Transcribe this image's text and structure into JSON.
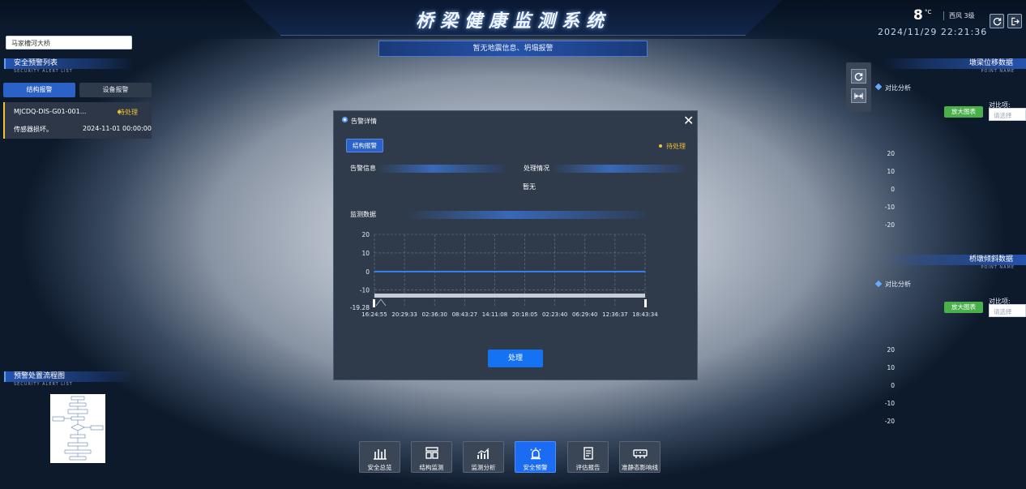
{
  "header": {
    "title": "桥梁健康监测系统",
    "temperature": "8",
    "temperature_unit": "°C",
    "wind": "西风 3级",
    "datetime": "2024/11/29 22:21:36",
    "icons": [
      "refresh-icon",
      "logout-icon"
    ]
  },
  "bridge_select": {
    "value": "马家槽河大桥"
  },
  "banner": {
    "text": "暂无地震信息、坍塌报警"
  },
  "left_panel": {
    "alert_list": {
      "title": "安全预警列表",
      "subtitle": "SECURITY ALERT LIST"
    },
    "tabs": [
      {
        "label": "结构报警",
        "active": true
      },
      {
        "label": "设备报警",
        "active": false
      }
    ],
    "alert": {
      "code": "MJCDQ-DIS-G01-001...",
      "status": "待处理",
      "description": "传感器损坏。",
      "time": "2024-11-01 00:00:00"
    },
    "flow": {
      "title": "预警处置流程图",
      "subtitle": "SECURITY ALERT LIST"
    }
  },
  "right_panel": {
    "beam": {
      "title": "墩梁位移数据",
      "subtitle": "POINT NAME",
      "analysis_label": "对比分析",
      "zoom_button": "放大图表",
      "compare_label": "对比项:",
      "compare_placeholder": "请选择",
      "y_ticks": [
        "20",
        "10",
        "0",
        "-10",
        "-20"
      ]
    },
    "pier": {
      "title": "桥墩倾斜数据",
      "subtitle": "POINT NAME",
      "analysis_label": "对比分析",
      "zoom_button": "放大图表",
      "compare_label": "对比项:",
      "compare_placeholder": "请选择",
      "y_ticks": [
        "20",
        "10",
        "0",
        "-10",
        "-20"
      ]
    }
  },
  "modal": {
    "title": "告警详情",
    "tab": "结构报警",
    "status": "待处理",
    "alert_info_label": "告警信息",
    "process_label": "处理情况",
    "process_value": "暂无",
    "monitor_label": "监测数据",
    "process_button": "处理",
    "status_color": "#f2c230"
  },
  "chart_data": {
    "type": "line",
    "y_ticks": [
      20,
      10,
      0,
      -10
    ],
    "y_min_label": -19.28,
    "ylim": [
      -19.28,
      20
    ],
    "x_ticks": [
      "16:24:55",
      "20:29:33",
      "02:36:30",
      "08:43:27",
      "14:11:08",
      "20:18:05",
      "02:23:40",
      "06:29:40",
      "12:36:37",
      "18:43:34"
    ],
    "series": [
      {
        "values": [
          0,
          0,
          0,
          0,
          0,
          0,
          0,
          0,
          0,
          0
        ],
        "color": "#3b7ff0"
      }
    ],
    "grid": true
  },
  "bottom_nav": [
    {
      "label": "安全总览",
      "icon": "overview-icon",
      "active": false
    },
    {
      "label": "结构监测",
      "icon": "structure-icon",
      "active": false
    },
    {
      "label": "监测分析",
      "icon": "analysis-icon",
      "active": false
    },
    {
      "label": "安全预警",
      "icon": "alarm-icon",
      "active": true
    },
    {
      "label": "评估报告",
      "icon": "report-icon",
      "active": false
    },
    {
      "label": "准静态影响线",
      "icon": "influence-line-icon",
      "active": false
    }
  ]
}
